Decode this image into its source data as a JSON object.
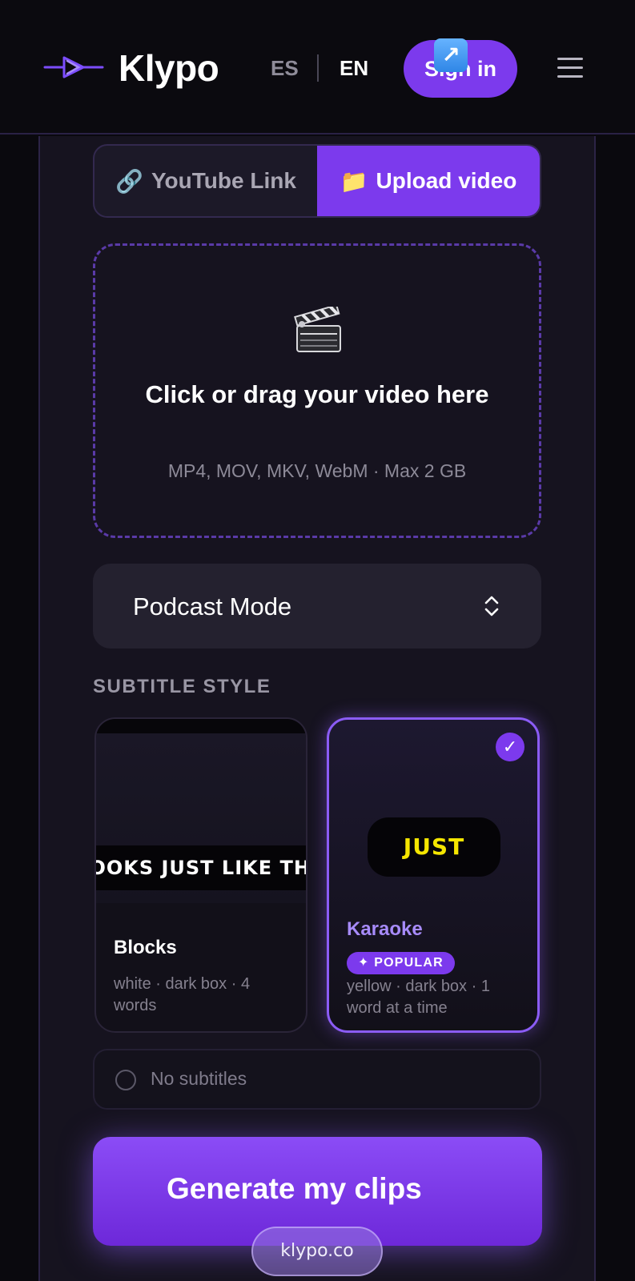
{
  "header": {
    "brand": "Klypo",
    "lang_es": "ES",
    "lang_en": "EN",
    "signin_label": "Sign in"
  },
  "tabs": [
    {
      "icon": "🔗",
      "label": "YouTube Link",
      "active": false
    },
    {
      "icon": "📁",
      "label": "Upload video",
      "active": true
    }
  ],
  "dropzone": {
    "title": "Click or drag your video here",
    "subtitle": "MP4, MOV, MKV, WebM · Max 2 GB"
  },
  "mode_select": {
    "value": "Podcast Mode"
  },
  "subtitle_style": {
    "title": "SUBTITLE STYLE",
    "cards": [
      {
        "name": "Blocks",
        "preview_text": "LOOKS JUST LIKE THE",
        "description": "white · dark box · 4 words",
        "selected": false
      },
      {
        "name": "Karaoke",
        "preview_text": "JUST",
        "badge": "✦ POPULAR",
        "description": "yellow · dark box · 1 word at a time",
        "selected": true,
        "check": "✓"
      }
    ],
    "none_option": "No subtitles"
  },
  "generate": {
    "label": "Generate my clips",
    "arrow": "↗"
  },
  "site": "klypo.co",
  "colors": {
    "accent": "#7c3aed",
    "karaoke_text": "#f5e600",
    "background": "#0a090e"
  }
}
